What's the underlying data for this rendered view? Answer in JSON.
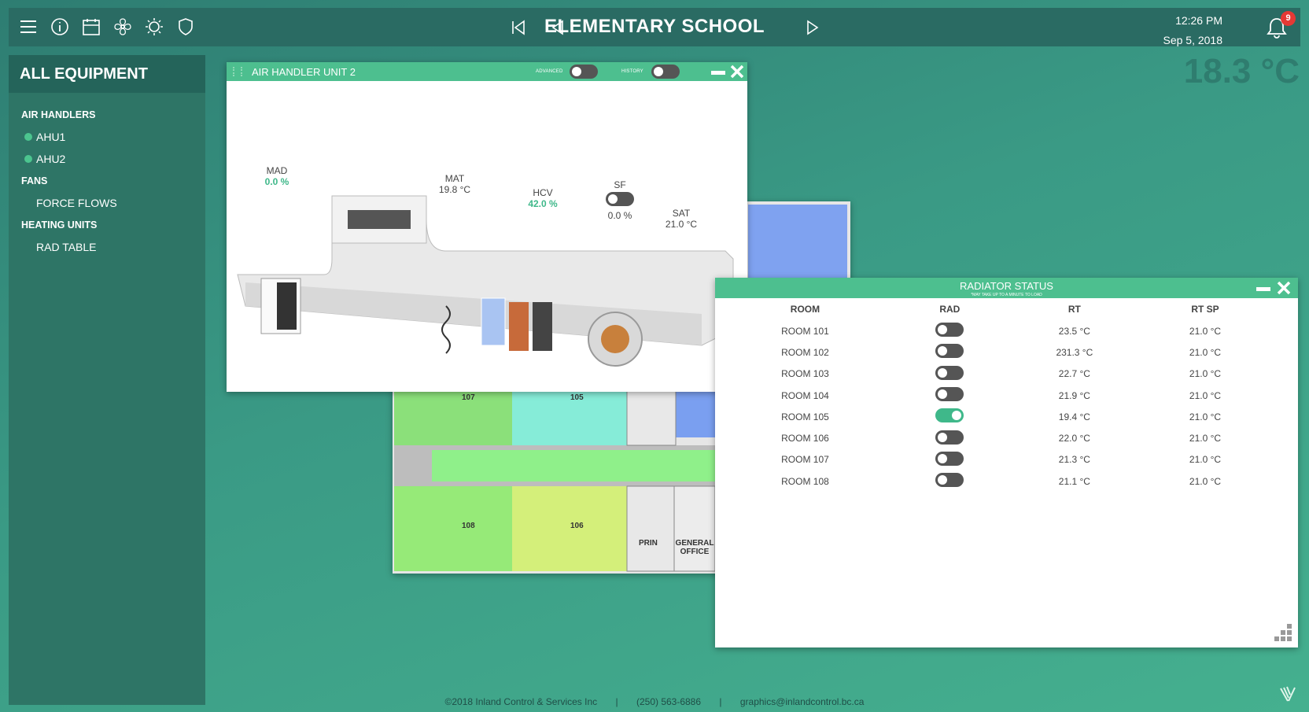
{
  "header": {
    "title": "ELEMENTARY SCHOOL",
    "time": "12:26 PM",
    "date": "Sep 5, 2018",
    "notifications": "9",
    "outside_temp": "18.3 °C",
    "icons": [
      "menu-icon",
      "info-icon",
      "calendar-icon",
      "fan-icon",
      "sun-icon",
      "shield-icon",
      "skip-first-icon",
      "prev-icon",
      "next-icon",
      "bell-icon"
    ]
  },
  "sidebar": {
    "title": "ALL EQUIPMENT",
    "sections": [
      {
        "label": "AIR HANDLERS"
      },
      {
        "label": "FANS"
      },
      {
        "label": "HEATING UNITS"
      }
    ],
    "items": {
      "ahu1": "AHU1",
      "ahu2": "AHU2",
      "force_flows": "FORCE FLOWS",
      "rad_table": "RAD TABLE"
    }
  },
  "ahu_window": {
    "title": "AIR HANDLER UNIT 2",
    "advanced_label": "ADVANCED",
    "history_label": "HISTORY",
    "points": {
      "mad": {
        "label": "MAD",
        "value": "0.0 %"
      },
      "mat": {
        "label": "MAT",
        "value": "19.8 °C"
      },
      "hcv": {
        "label": "HCV",
        "value": "42.0 %"
      },
      "sf": {
        "label": "SF",
        "value": "0.0 %",
        "on": false
      },
      "sat": {
        "label": "SAT",
        "value": "21.0 °C"
      }
    }
  },
  "floorplan": {
    "rooms": {
      "r107": "107",
      "r105": "105",
      "r108": "108",
      "r106": "106",
      "prin": "PRIN",
      "general": "GENERAL",
      "office": "OFFICE"
    }
  },
  "radiator_window": {
    "title": "RADIATOR STATUS",
    "subtitle": "*MAY TAKE UP TO A MINUTE TO LOAD",
    "columns": [
      "ROOM",
      "RAD",
      "RT",
      "RT SP"
    ],
    "rows": [
      {
        "room": "ROOM 101",
        "rad_on": false,
        "rt": "23.5 °C",
        "rtsp": "21.0 °C"
      },
      {
        "room": "ROOM 102",
        "rad_on": false,
        "rt": "231.3 °C",
        "rtsp": "21.0 °C"
      },
      {
        "room": "ROOM 103",
        "rad_on": false,
        "rt": "22.7 °C",
        "rtsp": "21.0 °C"
      },
      {
        "room": "ROOM 104",
        "rad_on": false,
        "rt": "21.9 °C",
        "rtsp": "21.0 °C"
      },
      {
        "room": "ROOM 105",
        "rad_on": true,
        "rt": "19.4 °C",
        "rtsp": "21.0 °C"
      },
      {
        "room": "ROOM 106",
        "rad_on": false,
        "rt": "22.0 °C",
        "rtsp": "21.0 °C"
      },
      {
        "room": "ROOM 107",
        "rad_on": false,
        "rt": "21.3 °C",
        "rtsp": "21.0 °C"
      },
      {
        "room": "ROOM 108",
        "rad_on": false,
        "rt": "21.1 °C",
        "rtsp": "21.0 °C"
      }
    ]
  },
  "footer": {
    "copyright": "©2018 Inland Control & Services Inc",
    "sep": "|",
    "phone": "(250) 563-6886",
    "email": "graphics@inlandcontrol.bc.ca"
  }
}
